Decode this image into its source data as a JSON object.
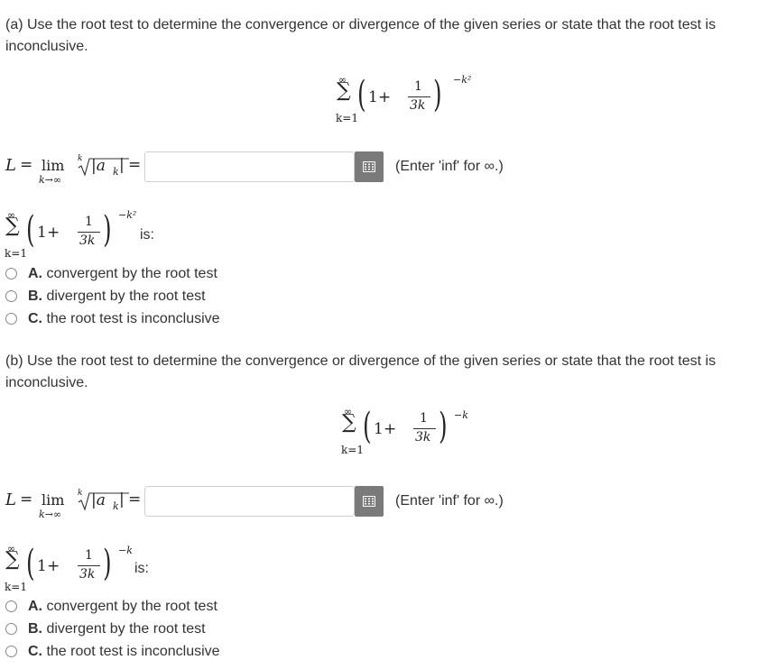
{
  "part_a": {
    "prompt": "(a) Use the root test to determine the convergence or divergence of the given series or state that the root test is inconclusive.",
    "series": {
      "sum_top": "∞",
      "sum_bottom": "k=1",
      "one": "1",
      "plus": "+",
      "num": "1",
      "den": "3k",
      "exponent": "−k²"
    },
    "limit": {
      "L": "L",
      "eq": "=",
      "lim": "lim",
      "sub": "k→∞",
      "root_index": "k",
      "abs": "|a",
      "abs_sub": "k",
      "abs_end": "|",
      "eq2": "="
    },
    "input_value": "",
    "hint": "(Enter 'inf' for ∞.)",
    "is_label": "is:",
    "options": [
      {
        "letter": "A.",
        "text": "convergent by the root test"
      },
      {
        "letter": "B.",
        "text": "divergent by the root test"
      },
      {
        "letter": "C.",
        "text": "the root test is inconclusive"
      }
    ]
  },
  "part_b": {
    "prompt": "(b) Use the root test to determine the convergence or divergence of the given series or state that the root test is inconclusive.",
    "series": {
      "sum_top": "∞",
      "sum_bottom": "k=1",
      "one": "1",
      "plus": "+",
      "num": "1",
      "den": "3k",
      "exponent": "−k"
    },
    "limit": {
      "L": "L",
      "eq": "=",
      "lim": "lim",
      "sub": "k→∞",
      "root_index": "k",
      "abs": "|a",
      "abs_sub": "k",
      "abs_end": "|",
      "eq2": "="
    },
    "input_value": "",
    "hint": "(Enter 'inf' for ∞.)",
    "is_label": "is:",
    "options": [
      {
        "letter": "A.",
        "text": "convergent by the root test"
      },
      {
        "letter": "B.",
        "text": "divergent by the root test"
      },
      {
        "letter": "C.",
        "text": "the root test is inconclusive"
      }
    ]
  },
  "colors": {
    "keypad_button": "#7a7a7a",
    "input_border": "#cfcfcf"
  },
  "icons": {
    "keypad": "keypad-icon",
    "radio": "radio-circle"
  }
}
